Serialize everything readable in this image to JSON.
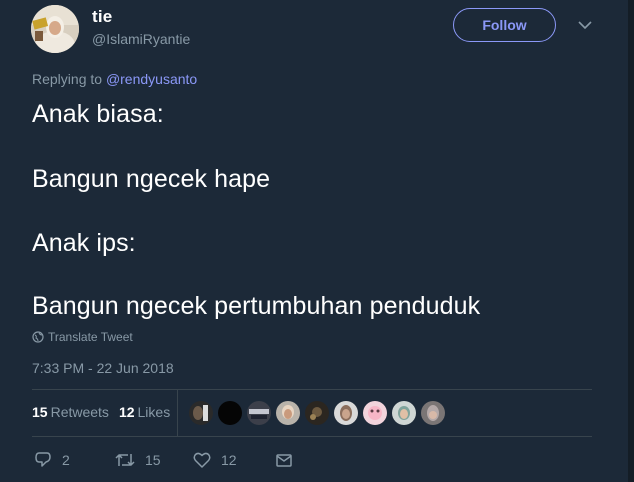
{
  "author": {
    "name": "tie",
    "handle": "@IslamiRyantie"
  },
  "follow_label": "Follow",
  "replying": {
    "prefix": "Replying to",
    "mention": "@rendyusanto"
  },
  "tweet_lines": [
    "Anak biasa:",
    "Bangun ngecek hape",
    "Anak ips:",
    "Bangun ngecek pertumbuhan penduduk"
  ],
  "translate_label": "Translate Tweet",
  "timestamp": "7:33 PM - 22 Jun 2018",
  "stats": {
    "retweets_count": "15",
    "retweets_label": "Retweets",
    "likes_count": "12",
    "likes_label": "Likes"
  },
  "actions": {
    "reply_count": "2",
    "retweet_count": "15",
    "like_count": "12"
  },
  "colors": {
    "background": "#1c2938",
    "accent": "#8b98f7",
    "secondary_text": "#8899a6"
  },
  "icons": [
    "caret-down-icon",
    "globe-icon",
    "reply-icon",
    "retweet-icon",
    "heart-icon",
    "message-icon"
  ]
}
